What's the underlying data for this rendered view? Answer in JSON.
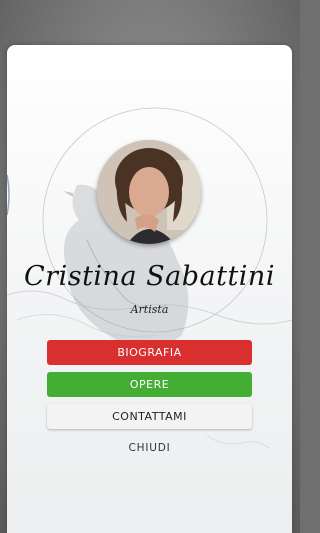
{
  "profile": {
    "name": "Cristina Sabattini",
    "role": "Artista"
  },
  "buttons": {
    "biography": "BIOGRAFIA",
    "works": "OPERE",
    "contact": "CONTATTAMI"
  },
  "close_label": "CHIUDI",
  "colors": {
    "biography": "#d9302f",
    "works": "#44ad34",
    "contact": "#f3f3f3"
  },
  "icons": {
    "avatar": "portrait-photo",
    "artwork": "bird-illustration"
  }
}
